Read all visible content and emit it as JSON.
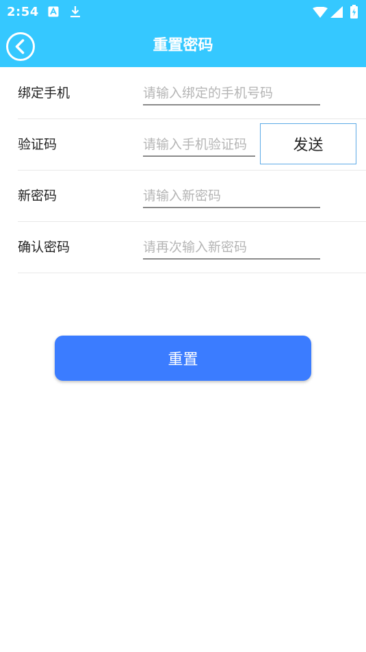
{
  "status_bar": {
    "time": "2:54",
    "icons": [
      "notification-a-icon",
      "download-icon",
      "wifi-icon",
      "cell-signal-icon",
      "battery-charging-icon"
    ]
  },
  "app_bar": {
    "title": "重置密码",
    "back_icon": "back-circle-icon"
  },
  "form": {
    "phone": {
      "label": "绑定手机",
      "placeholder": "请输入绑定的手机号码",
      "value": ""
    },
    "code": {
      "label": "验证码",
      "placeholder": "请输入手机验证码",
      "value": "",
      "send_label": "发送"
    },
    "new_password": {
      "label": "新密码",
      "placeholder": "请输入新密码",
      "value": ""
    },
    "confirm_password": {
      "label": "确认密码",
      "placeholder": "请再次输入新密码",
      "value": ""
    }
  },
  "reset_button": {
    "label": "重置"
  },
  "colors": {
    "app_bar": "#35c8ff",
    "primary_button": "#3b7cff",
    "send_border": "#5aa9e6",
    "placeholder": "#b5b5b5"
  }
}
